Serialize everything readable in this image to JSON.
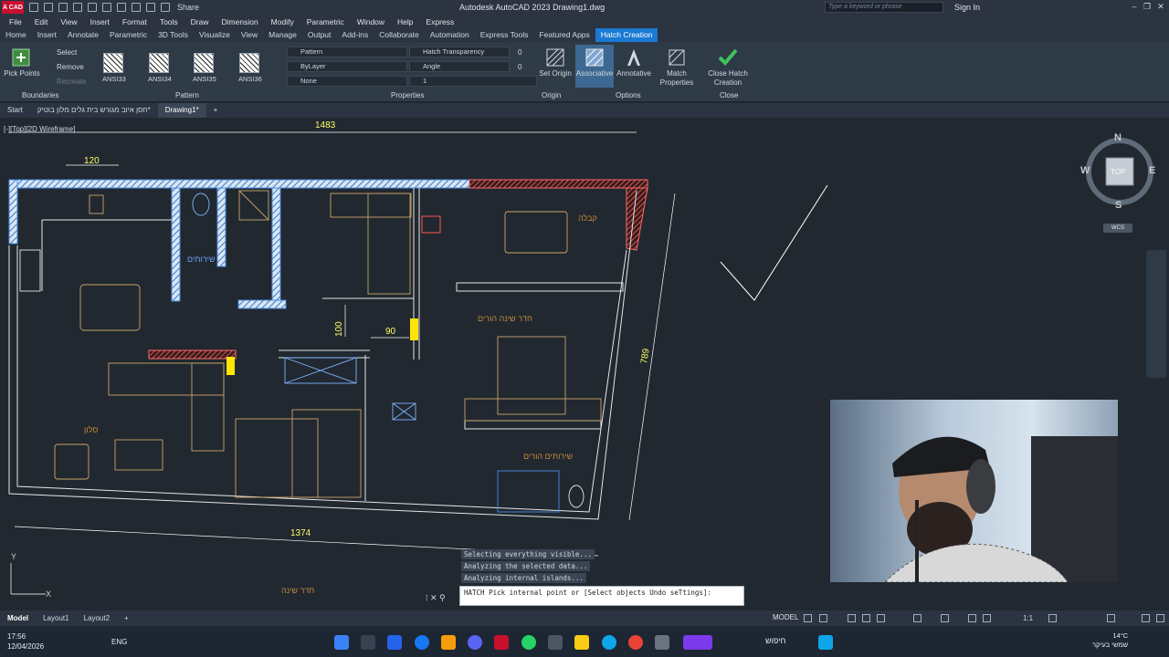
{
  "titlebar": {
    "logo": "A CAD",
    "share": "Share",
    "title": "Autodesk AutoCAD 2023   Drawing1.dwg",
    "search_placeholder": "Type a keyword or phrase",
    "sign_in": "Sign In"
  },
  "menu": [
    "File",
    "Edit",
    "View",
    "Insert",
    "Format",
    "Tools",
    "Draw",
    "Dimension",
    "Modify",
    "Parametric",
    "Window",
    "Help",
    "Express"
  ],
  "ribbon_tabs": [
    "Home",
    "Insert",
    "Annotate",
    "Parametric",
    "3D Tools",
    "Visualize",
    "View",
    "Manage",
    "Output",
    "Add-ins",
    "Collaborate",
    "Automation",
    "Express Tools",
    "Featured Apps",
    "Hatch Creation"
  ],
  "ribbon_active_tab": "Hatch Creation",
  "ribbon": {
    "boundaries": {
      "title": "Boundaries",
      "pick_points": "Pick Points",
      "select": "Select",
      "remove": "Remove",
      "recreate": "Recreate"
    },
    "pattern": {
      "title": "Pattern",
      "swatches": [
        "ANSI33",
        "ANSI34",
        "ANSI35",
        "ANSI36"
      ]
    },
    "properties": {
      "title": "Properties",
      "type": "Pattern",
      "color": "ByLayer",
      "background": "None",
      "transparency_label": "Hatch Transparency",
      "transparency_value": "0",
      "angle_label": "Angle",
      "angle_value": "0",
      "scale_value": "1"
    },
    "origin": {
      "title": "Origin",
      "set_origin": "Set Origin"
    },
    "options": {
      "title": "Options",
      "associative": "Associative",
      "annotative": "Annotative",
      "match_properties": "Match Properties"
    },
    "close": {
      "title": "Close",
      "close_hatch": "Close Hatch Creation"
    }
  },
  "file_tabs": [
    "Start",
    "חסן איוב מגורש בית גלים מלון בוטיק*",
    "Drawing1*"
  ],
  "active_file_tab": "Drawing1*",
  "viewport_label": "[-][Top][2D Wireframe]",
  "dimensions": {
    "top": "1483",
    "d120": "120",
    "d100": "100",
    "d90": "90",
    "right": "789",
    "bottom": "1374"
  },
  "room_labels": {
    "bathroom": "שירותים",
    "reception": "קבלה",
    "parents_bedroom": "חדר שינה הורים",
    "salon": "סלון",
    "parents_wc": "שירותים הורים",
    "bedroom": "חדר שינה"
  },
  "viewcube": {
    "north": "N",
    "south": "S",
    "east": "E",
    "west": "W",
    "top": "TOP",
    "wcs": "WCS"
  },
  "command": {
    "history": [
      "Selecting everything visible...",
      "Analyzing the selected data...",
      "Analyzing internal islands..."
    ],
    "prompt": "HATCH Pick internal point or [Select objects Undo seTtings]:"
  },
  "layout_tabs": [
    "Model",
    "Layout1",
    "Layout2"
  ],
  "active_layout": "Model",
  "status": {
    "model": "MODEL",
    "scale": "1:1"
  },
  "taskbar": {
    "time": "17:56",
    "date": "12/04/2026",
    "lang": "ENG",
    "search": "חיפוש",
    "weather_temp": "14°C",
    "weather_desc": "שמשי בעיקר"
  },
  "colors": {
    "accent": "#1a79d4",
    "wall": "#6fb2ff",
    "hatch_red": "#ff6b6b",
    "furniture": "#c9a56a",
    "dim_yellow": "#ffff66",
    "highlight": "#ffe500"
  }
}
